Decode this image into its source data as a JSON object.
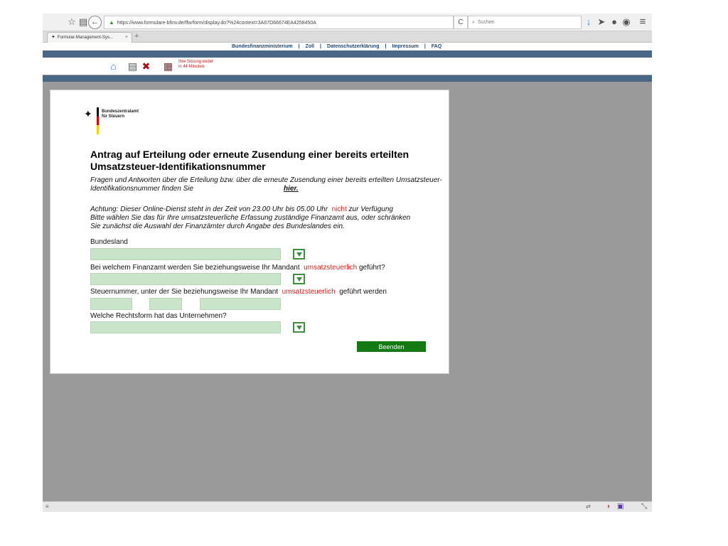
{
  "browser": {
    "url": "https://www.formulare-bfinv.de/ffw/form/display.do?%24context=3A67D66674EA4258450A",
    "search_placeholder": "Suchen",
    "tab_title": "Formular-Management-Sys...",
    "tab_close": "×",
    "new_tab": "+",
    "reload": "C",
    "back": "←",
    "icons": {
      "star": "☆",
      "history": "▤",
      "lock": "▲",
      "download": "↓",
      "send": "➤",
      "secure": "●",
      "pocket": "◉",
      "menu": "≡",
      "resize": "⤡"
    }
  },
  "site_nav": {
    "items": [
      "Bundesfinanzministerium",
      "Zoll",
      "Datenschutzerklärung",
      "Impressum",
      "FAQ"
    ],
    "separator": "|"
  },
  "toolbar": {
    "session_line1": "Ihre Sitzung endet",
    "session_line2": "in 44 Minuten."
  },
  "form": {
    "logo_line1": "Bundeszentralamt",
    "logo_line2": "für Steuern",
    "title": "Antrag auf Erteilung oder erneute Zusendung einer bereits erteilten Umsatzsteuer-Identifikationsnummer",
    "intro": "Fragen und Antworten über die Erteilung bzw. über die erneute Zusendung einer bereits erteilten Umsatzsteuer-Identifikationsnummer finden Sie",
    "intro_link": "hier.",
    "notice_pre": "Achtung: Dieser Online-Dienst steht in der Zeit von 23.00 Uhr bis 05.00 Uhr",
    "notice_red": "nicht",
    "notice_post": "zur Verfügung",
    "notice_line2": "Bitte wählen Sie das für Ihre umsatzsteuerliche Erfassung zuständige Finanzamt aus, oder schränken",
    "notice_line3": "Sie zunächst die Auswahl der Finanzämter durch Angabe des Bundeslandes ein.",
    "label_bundesland": "Bundesland",
    "label_finanzamt_pre": "Bei welchem Finanzamt werden Sie beziehungsweise Ihr Mandant",
    "label_finanzamt_red": "umsatzsteuerlich",
    "label_finanzamt_post": "geführt?",
    "label_steuernr_pre": "Steuernummer, unter der Sie beziehungsweise Ihr Mandant",
    "label_steuernr_red": "umsatzsteuerlich",
    "label_steuernr_post": "geführt werden",
    "label_rechtsform": "Welche Rechtsform hat das Unternehmen?",
    "submit_label": "Beenden"
  },
  "colors": {
    "field_bg": "#c9e4c9",
    "button_green": "#137a13",
    "nav_blue": "#4a6886",
    "accent_red": "#d22222"
  }
}
